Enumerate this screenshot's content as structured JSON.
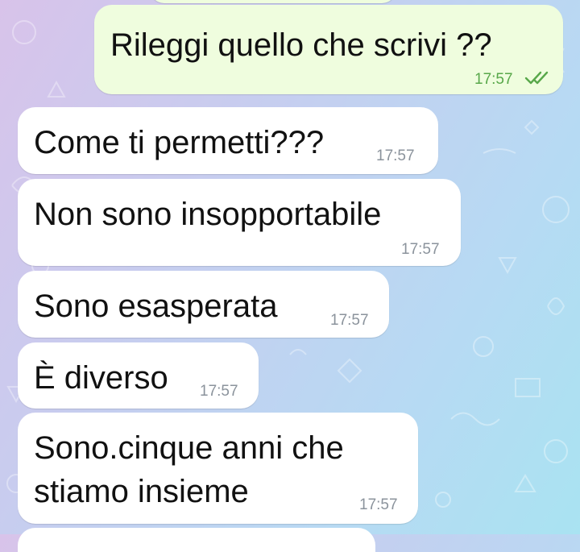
{
  "chat": {
    "messages": [
      {
        "id": "m1",
        "direction": "outgoing",
        "lines": [
          "Rileggi quello che scrivi ??"
        ],
        "time": "17:57",
        "status": "read"
      },
      {
        "id": "m2",
        "direction": "incoming",
        "lines": [
          "Come ti permetti???"
        ],
        "time": "17:57"
      },
      {
        "id": "m3",
        "direction": "incoming",
        "lines": [
          "Non sono insopportabile"
        ],
        "time": "17:57"
      },
      {
        "id": "m4",
        "direction": "incoming",
        "lines": [
          "Sono esasperata"
        ],
        "time": "17:57"
      },
      {
        "id": "m5",
        "direction": "incoming",
        "lines": [
          "È diverso"
        ],
        "time": "17:57"
      },
      {
        "id": "m6",
        "direction": "incoming",
        "lines": [
          "Sono.cinque anni che",
          "stiamo insieme"
        ],
        "time": "17:57"
      }
    ]
  },
  "colors": {
    "outgoing_bubble": "#effdde",
    "incoming_bubble": "#ffffff",
    "read_ticks": "#58a84a",
    "time_text": "#8b939c"
  },
  "icons": {
    "read_status": "double-check-icon"
  }
}
